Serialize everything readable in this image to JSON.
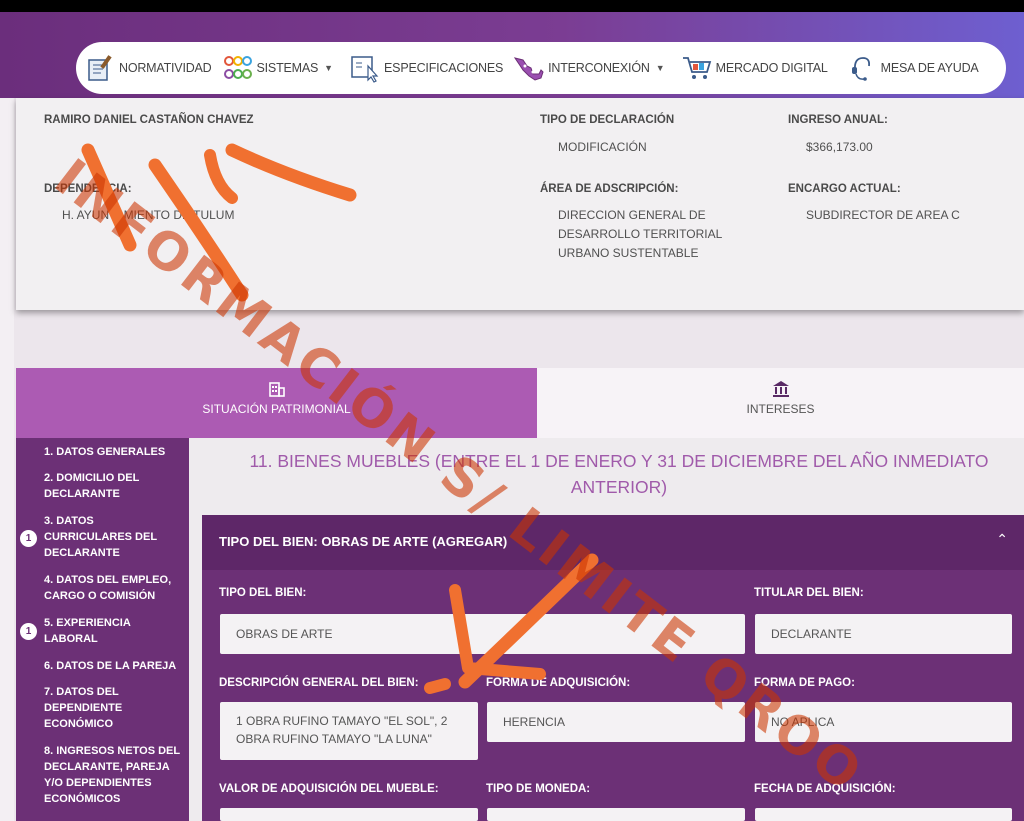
{
  "nav": {
    "items": [
      {
        "label": "NORMATIVIDAD",
        "icon": "law-book-icon",
        "dropdown": false
      },
      {
        "label": "SISTEMAS",
        "icon": "circles-grid-icon",
        "dropdown": true
      },
      {
        "label": "ESPECIFICACIONES",
        "icon": "document-pointer-icon",
        "dropdown": false
      },
      {
        "label": "INTERCONEXIÓN",
        "icon": "mexico-map-icon",
        "dropdown": true
      },
      {
        "label": "MERCADO DIGITAL",
        "icon": "shopping-cart-icon",
        "dropdown": false
      },
      {
        "label": "MESA DE AYUDA",
        "icon": "headset-icon",
        "dropdown": false
      }
    ]
  },
  "declarant": {
    "name": "RAMIRO DANIEL CASTAÑON CHAVEZ",
    "dependencia_label": "DEPENDENCIA:",
    "dependencia_value": "H. AYUNTAMIENTO DE TULUM",
    "tipo_label": "TIPO DE DECLARACIÓN",
    "tipo_value": "MODIFICACIÓN",
    "ingreso_label": "INGRESO ANUAL:",
    "ingreso_value": "$366,173.00",
    "area_label": "ÁREA DE ADSCRIPCIÓN:",
    "area_value": "DIRECCION GENERAL DE DESARROLLO TERRITORIAL URBANO SUSTENTABLE",
    "encargo_label": "ENCARGO ACTUAL:",
    "encargo_value": "SUBDIRECTOR DE AREA C"
  },
  "tabs": [
    {
      "label": "SITUACIÓN PATRIMONIAL",
      "icon": "building-icon",
      "active": true
    },
    {
      "label": "INTERESES",
      "icon": "bank-icon",
      "active": false
    }
  ],
  "sidebar": {
    "items": [
      {
        "label": "1. DATOS GENERALES",
        "badge": ""
      },
      {
        "label": "2. DOMICILIO DEL DECLARANTE",
        "badge": ""
      },
      {
        "label": "3. DATOS CURRICULARES DEL DECLARANTE",
        "badge": "1"
      },
      {
        "label": "4. DATOS DEL EMPLEO, CARGO O COMISIÓN",
        "badge": ""
      },
      {
        "label": "5. EXPERIENCIA LABORAL",
        "badge": "1"
      },
      {
        "label": "6. DATOS DE LA PAREJA",
        "badge": ""
      },
      {
        "label": "7. DATOS DEL DEPENDIENTE ECONÓMICO",
        "badge": ""
      },
      {
        "label": "8. INGRESOS NETOS DEL DECLARANTE, PAREJA Y/O DEPENDIENTES ECONÓMICOS",
        "badge": ""
      }
    ]
  },
  "section": {
    "title": "11. BIENES MUEBLES (ENTRE EL 1 DE ENERO Y 31 DE DICIEMBRE DEL AÑO INMEDIATO ANTERIOR)"
  },
  "panel": {
    "title": "TIPO DEL BIEN: OBRAS DE ARTE (AGREGAR)",
    "tipo_label": "TIPO DEL BIEN:",
    "tipo_value": "OBRAS DE ARTE",
    "titular_label": "TITULAR DEL BIEN:",
    "titular_value": "DECLARANTE",
    "descripcion_label": "DESCRIPCIÓN GENERAL DEL BIEN:",
    "descripcion_value": "1 OBRA RUFINO TAMAYO \"EL SOL\", 2 OBRA RUFINO TAMAYO \"LA LUNA\"",
    "forma_adq_label": "FORMA DE ADQUISICIÓN:",
    "forma_adq_value": "HERENCIA",
    "forma_pago_label": "FORMA DE PAGO:",
    "forma_pago_value": "NO APLICA",
    "valor_label": "VALOR DE ADQUISICIÓN DEL MUEBLE:",
    "moneda_label": "TIPO DE MONEDA:",
    "fecha_label": "FECHA DE ADQUISICIÓN:"
  },
  "watermark": {
    "text": "INFORMACIÓN S/ LIMITE QROO",
    "color": "#cc3300"
  },
  "colors": {
    "primary": "#6c3076",
    "tab_active": "#ac5bb3",
    "title": "#a05aaa",
    "annotation": "#f07030"
  }
}
